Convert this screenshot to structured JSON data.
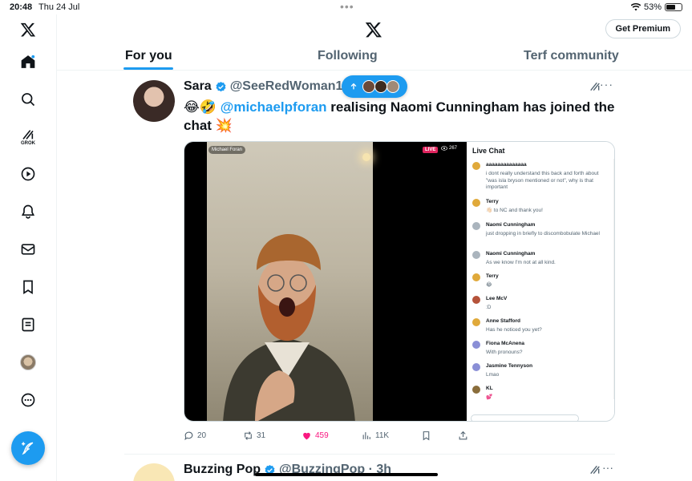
{
  "status_bar": {
    "time": "20:48",
    "date": "Thu 24 Jul",
    "battery": "53%",
    "battery_level": 0.53
  },
  "sidebar": {
    "items": [
      {
        "name": "home",
        "icon": "home-icon"
      },
      {
        "name": "explore",
        "icon": "search-icon"
      },
      {
        "name": "grok",
        "icon": "grok-icon",
        "label": "GROK"
      },
      {
        "name": "videos",
        "icon": "play-icon"
      },
      {
        "name": "notifications",
        "icon": "bell-icon"
      },
      {
        "name": "messages",
        "icon": "mail-icon"
      },
      {
        "name": "bookmarks",
        "icon": "bookmark-icon"
      },
      {
        "name": "lists",
        "icon": "list-icon"
      },
      {
        "name": "profile",
        "icon": "avatar-icon"
      },
      {
        "name": "more",
        "icon": "more-circle-icon"
      }
    ],
    "compose_icon": "feather-plus-icon"
  },
  "header": {
    "premium_label": "Get Premium",
    "tabs": [
      {
        "label": "For you",
        "active": true
      },
      {
        "label": "Following",
        "active": false
      },
      {
        "label": "Terf community",
        "active": false
      }
    ]
  },
  "tweet": {
    "name": "Sara",
    "handle": "@SeeRedWoman1",
    "emojis": "😂🤣",
    "mention": "@michaelpforan",
    "text": " realising Naomi Cunningham has joined the chat",
    "trailing_emoji": "💥",
    "media": {
      "host_tag": "Michael Foran",
      "live_label": "LIVE",
      "viewer_count": "267",
      "chat_title": "Live Chat",
      "chat": [
        {
          "user": "aaaaaaaaaaaaaa",
          "body": "i dont really understand this back and forth about \"was isla bryson mentioned or not\", why is that important",
          "color": "#e0a93a"
        },
        {
          "user": "Terry",
          "body": "👋🏻 to NC and thank you!",
          "color": "#e0a93a"
        },
        {
          "user": "Naomi Cunningham",
          "body": "just dropping in briefly to discombobulate Michael",
          "color": "#aab4bd"
        },
        {
          "user": "Naomi Cunningham",
          "body": "As we know I'm not at all kind.",
          "color": "#aab4bd"
        },
        {
          "user": "Terry",
          "body": "😂",
          "color": "#e0a93a"
        },
        {
          "user": "Lee McV",
          "body": ":D",
          "color": "#b5533a"
        },
        {
          "user": "Anne Stafford",
          "body": "Has he noticed you yet?",
          "color": "#e0a93a"
        },
        {
          "user": "Fiona McAnena",
          "body": "With pronouns?",
          "color": "#8a8fd6"
        },
        {
          "user": "Jasmine Tennyson",
          "body": "Lmao",
          "color": "#8a8fd6"
        },
        {
          "user": "KL",
          "body": "💕",
          "color": "#8a6d3b"
        }
      ]
    },
    "actions": {
      "replies": "20",
      "reposts": "31",
      "likes": "459",
      "views": "11K"
    }
  },
  "next_tweet": {
    "name": "Buzzing Pop",
    "handle": "@BuzzingPop · 3h"
  },
  "colors": {
    "accent": "#1d9bf0",
    "like": "#f91880",
    "text": "#0f1419",
    "muted": "#536471"
  }
}
